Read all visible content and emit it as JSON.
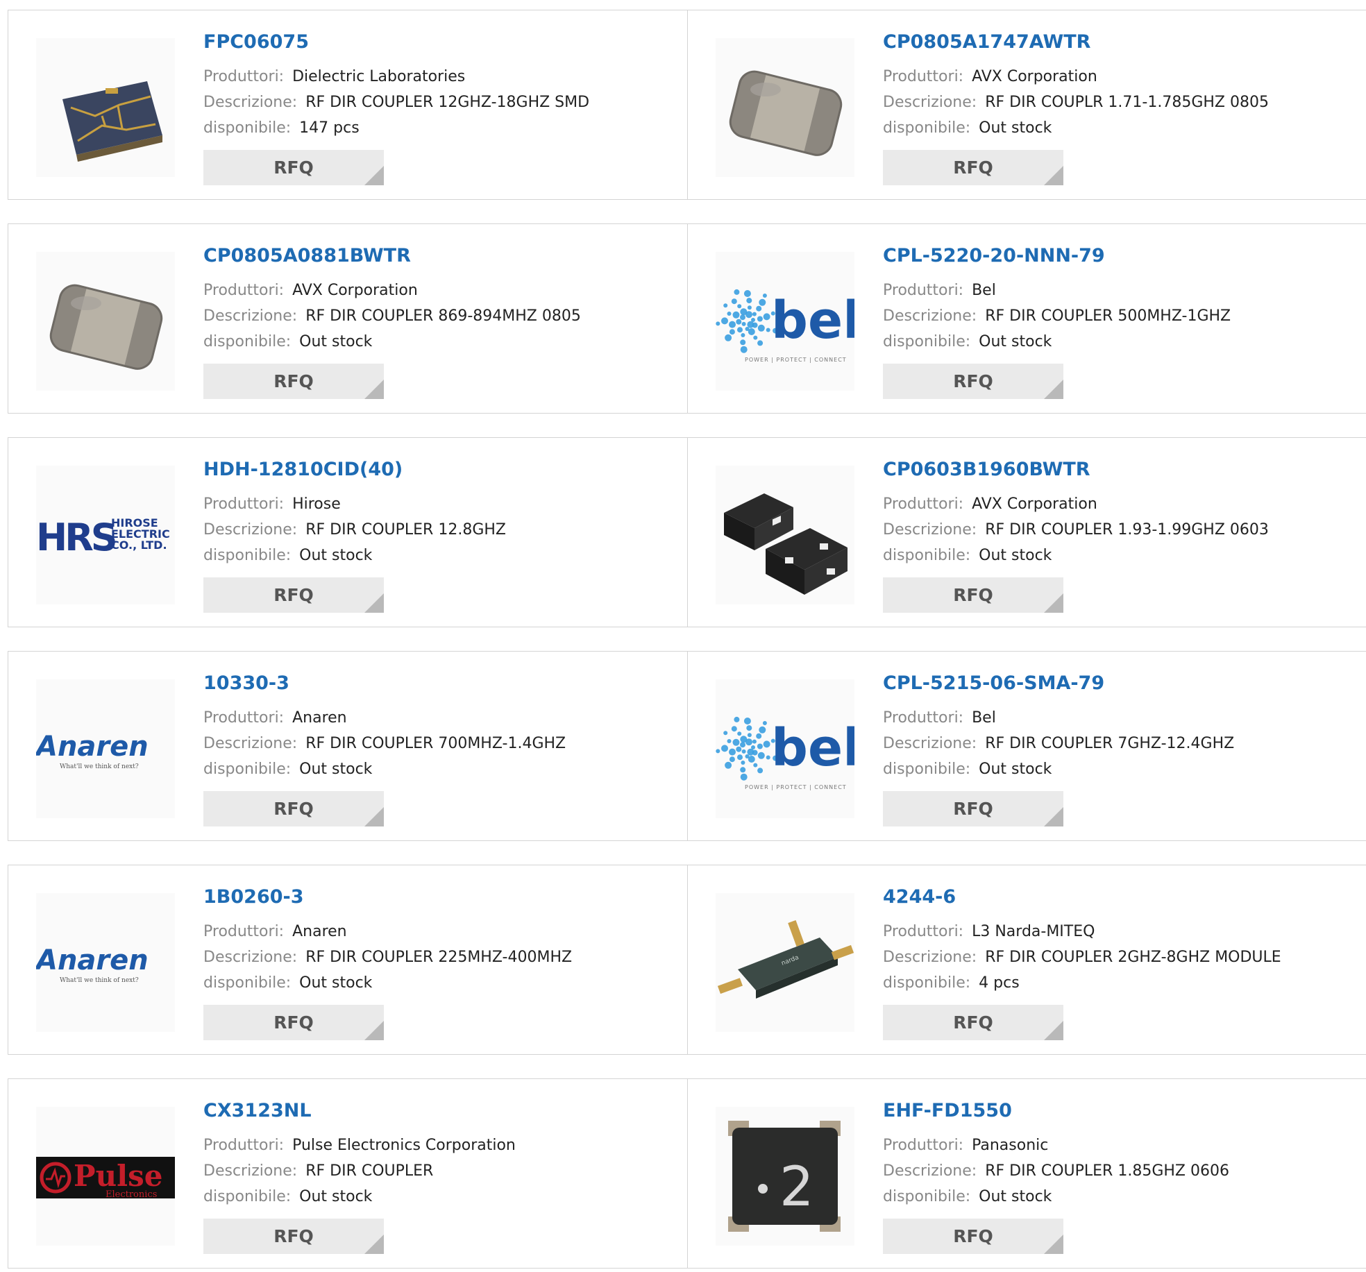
{
  "labels": {
    "manufacturer": "Produttori:",
    "description": "Descrizione:",
    "availability": "disponibile:",
    "rfq": "RFQ"
  },
  "products": [
    {
      "part_number": "FPC06075",
      "manufacturer": "Dielectric Laboratories",
      "description": "RF DIR COUPLER 12GHZ-18GHZ SMD",
      "availability": "147 pcs",
      "image": "gold-trace-coupler-chip"
    },
    {
      "part_number": "CP0805A1747AWTR",
      "manufacturer": "AVX Corporation",
      "description": "RF DIR COUPLR 1.71-1.785GHZ 0805",
      "availability": "Out stock",
      "image": "ceramic-0805-chip"
    },
    {
      "part_number": "CP0805A0881BWTR",
      "manufacturer": "AVX Corporation",
      "description": "RF DIR COUPLER 869-894MHZ 0805",
      "availability": "Out stock",
      "image": "ceramic-0805-chip"
    },
    {
      "part_number": "CPL-5220-20-NNN-79",
      "manufacturer": "Bel",
      "description": "RF DIR COUPLER 500MHZ-1GHZ",
      "availability": "Out stock",
      "image": "bel-logo",
      "logo": {
        "word": "bel",
        "tagline": "POWER | PROTECT | CONNECT"
      }
    },
    {
      "part_number": "HDH-12810CID(40)",
      "manufacturer": "Hirose",
      "description": "RF DIR COUPLER 12.8GHZ",
      "availability": "Out stock",
      "image": "hirose-logo",
      "logo": {
        "mark": "HRS",
        "lines": [
          "HIROSE",
          "ELECTRIC",
          "CO., LTD."
        ]
      }
    },
    {
      "part_number": "CP0603B1960BWTR",
      "manufacturer": "AVX Corporation",
      "description": "RF DIR COUPLER 1.93-1.99GHZ 0603",
      "availability": "Out stock",
      "image": "black-0603-packages"
    },
    {
      "part_number": "10330-3",
      "manufacturer": "Anaren",
      "description": "RF DIR COUPLER 700MHZ-1.4GHZ",
      "availability": "Out stock",
      "image": "anaren-logo",
      "logo": {
        "word": "Anaren",
        "tagline": "What'll we think of next?"
      }
    },
    {
      "part_number": "CPL-5215-06-SMA-79",
      "manufacturer": "Bel",
      "description": "RF DIR COUPLER 7GHZ-12.4GHZ",
      "availability": "Out stock",
      "image": "bel-logo",
      "logo": {
        "word": "bel",
        "tagline": "POWER | PROTECT | CONNECT"
      }
    },
    {
      "part_number": "1B0260-3",
      "manufacturer": "Anaren",
      "description": "RF DIR COUPLER 225MHZ-400MHZ",
      "availability": "Out stock",
      "image": "anaren-logo",
      "logo": {
        "word": "Anaren",
        "tagline": "What'll we think of next?"
      }
    },
    {
      "part_number": "4244-6",
      "manufacturer": "L3 Narda-MITEQ",
      "description": "RF DIR COUPLER 2GHZ-8GHZ MODULE",
      "availability": "4 pcs",
      "image": "sma-coupler-module"
    },
    {
      "part_number": "CX3123NL",
      "manufacturer": "Pulse Electronics Corporation",
      "description": "RF DIR COUPLER",
      "availability": "Out stock",
      "image": "pulse-logo",
      "logo": {
        "word": "Pulse",
        "tagline": "Electronics"
      }
    },
    {
      "part_number": "EHF-FD1550",
      "manufacturer": "Panasonic",
      "description": "RF DIR COUPLER 1.85GHZ 0606",
      "availability": "Out stock",
      "image": "black-chip-marked-2",
      "marking": "2"
    }
  ]
}
